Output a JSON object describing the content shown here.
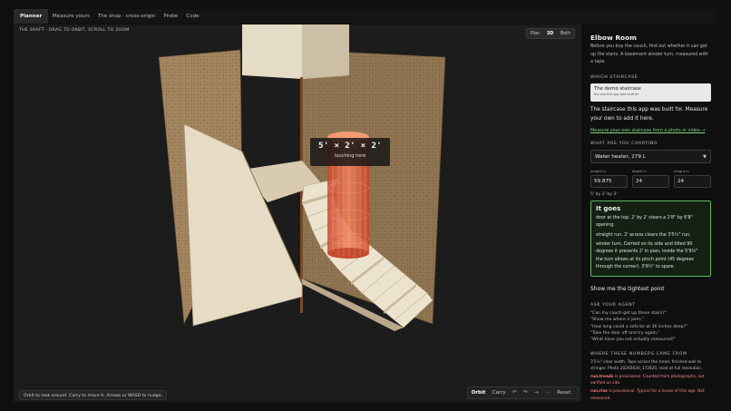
{
  "nav": {
    "tabs": [
      {
        "label": "Planner",
        "active": true
      },
      {
        "label": "Measure yours",
        "active": false
      },
      {
        "label": "The shop · cross-origin",
        "active": false
      },
      {
        "label": "Probe",
        "active": false
      },
      {
        "label": "Code",
        "active": false
      }
    ]
  },
  "viewport": {
    "caption": "THE SHAFT · DRAG TO ORBIT, SCROLL TO ZOOM",
    "view_modes": [
      "Plan",
      "3D",
      "Both"
    ],
    "active_view": "3D",
    "dimension_label": "5' × 2' × 2'",
    "touching_label": "touching here",
    "hint": "Orbit to look around. Carry to move it. Arrows or WASD to nudge.",
    "controls": {
      "orbit": "Orbit",
      "carry": "Carry",
      "icons": [
        "↶",
        "↷",
        "⇢",
        "⋯"
      ],
      "reset": "Reset"
    }
  },
  "colors": {
    "accent_green": "#7ed37e",
    "verdict_border": "#5fb85f",
    "provisional_red": "#ff7a7a",
    "object_orange": "#e8623c",
    "wall_brown": "#a88a62",
    "stair_cream": "#e2d6bb"
  },
  "panel": {
    "title": "Elbow Room",
    "intro": "Before you buy the couch, find out whether it can get up the stairs. A basement winder turn, measured with a tape.",
    "which_staircase_heading": "WHICH STAIRCASE",
    "staircase_card": {
      "name": "The demo staircase",
      "sub": "the one this app was built for"
    },
    "staircase_desc": "The staircase this app was built for. Measure your own to add it here.",
    "measure_link": "Measure your own staircase from a photo or video →",
    "carrying_heading": "WHAT ARE YOU CARRYING",
    "carrying_value": "Water heater, 279 L",
    "dims": [
      {
        "label": "length in",
        "value": "59.875"
      },
      {
        "label": "depth in",
        "value": "24"
      },
      {
        "label": "height in",
        "value": "24"
      }
    ],
    "size_note": "5' by 2' by 2'",
    "verdict": {
      "title": "It goes",
      "lines": [
        "door at the top. 2' by 2' clears a 2'8\" by 6'8\" opening.",
        "straight run. 2' across clears the 3'5½\" run.",
        "winder turn. Carried on its side and tilted 90 degrees it presents 2' in plan, inside the 5'9½\" the turn allows at its pinch point (45 degrees through the corner). 3'9½\" to spare."
      ]
    },
    "tightest_label": "Show me the tightest point",
    "agent_heading": "ASK YOUR AGENT",
    "agent_quotes": [
      "\"Can my couch get up these stairs?\"",
      "\"Show me where it jams.\"",
      "\"How long could a sofa be at 36 inches deep?\"",
      "\"Take the door off and try again.\"",
      "\"What have you not actually measured?\""
    ],
    "sources_heading": "WHERE THESE NUMBERS CAME FROM",
    "sources": [
      {
        "key": "",
        "text": "3'5½\" clear width. Tape across the tread, finished wall to stringer. Photo 20260830_172820, read at full resolution.",
        "warn": false
      },
      {
        "key": "run,treads",
        "text": "is provisional. Counted from photographs, not verified on site.",
        "warn": true
      },
      {
        "key": "run,rise",
        "text": "is provisional. Typical for a house of this age. Not measured.",
        "warn": true
      }
    ]
  }
}
